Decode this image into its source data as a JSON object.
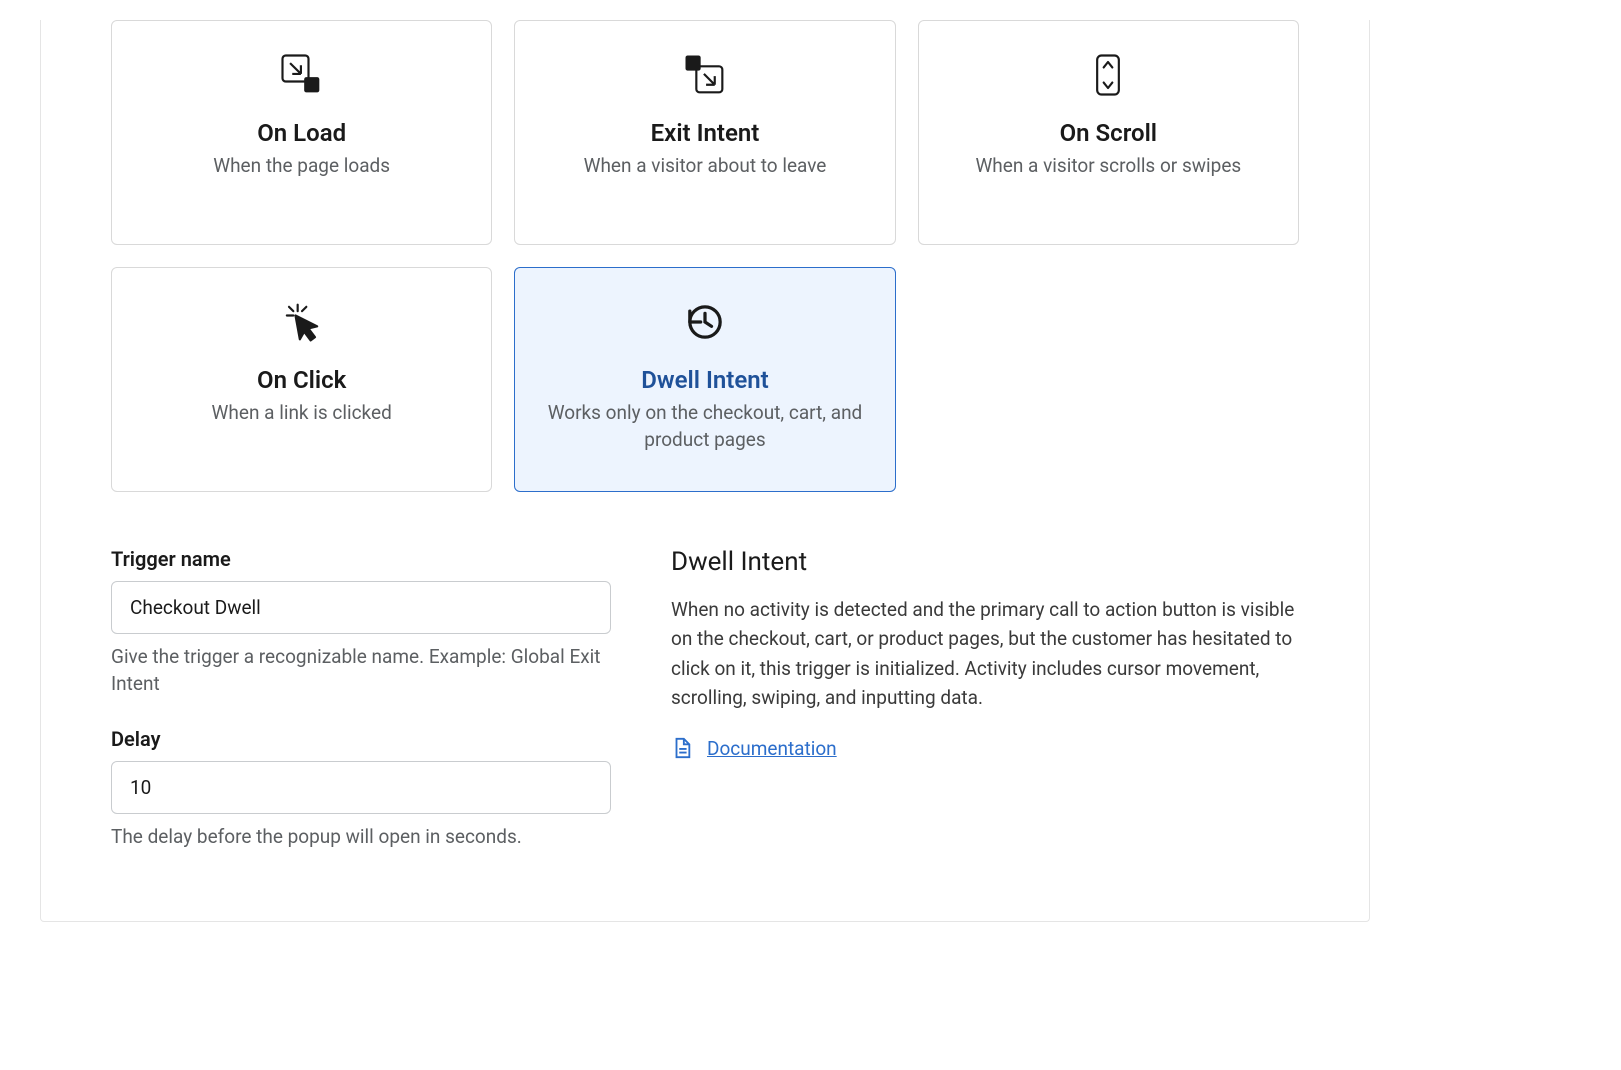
{
  "triggers": [
    {
      "id": "on-load",
      "title": "On Load",
      "desc": "When the page loads",
      "selected": false
    },
    {
      "id": "exit-intent",
      "title": "Exit Intent",
      "desc": "When a visitor about to leave",
      "selected": false
    },
    {
      "id": "on-scroll",
      "title": "On Scroll",
      "desc": "When a visitor scrolls or swipes",
      "selected": false
    },
    {
      "id": "on-click",
      "title": "On Click",
      "desc": "When a link is clicked",
      "selected": false
    },
    {
      "id": "dwell-intent",
      "title": "Dwell Intent",
      "desc": "Works only on the checkout, cart, and product pages",
      "selected": true
    }
  ],
  "form": {
    "trigger_name_label": "Trigger name",
    "trigger_name_value": "Checkout Dwell",
    "trigger_name_help": "Give the trigger a recognizable name. Example: Global Exit Intent",
    "delay_label": "Delay",
    "delay_value": "10",
    "delay_help": "The delay before the popup will open in seconds."
  },
  "info": {
    "title": "Dwell Intent",
    "desc": "When no activity is detected and the primary call to action button is visible on the checkout, cart, or product pages, but the customer has hesitated to click on it, this trigger is initialized. Activity includes cursor movement, scrolling, swiping, and inputting data.",
    "doc_label": "Documentation"
  }
}
